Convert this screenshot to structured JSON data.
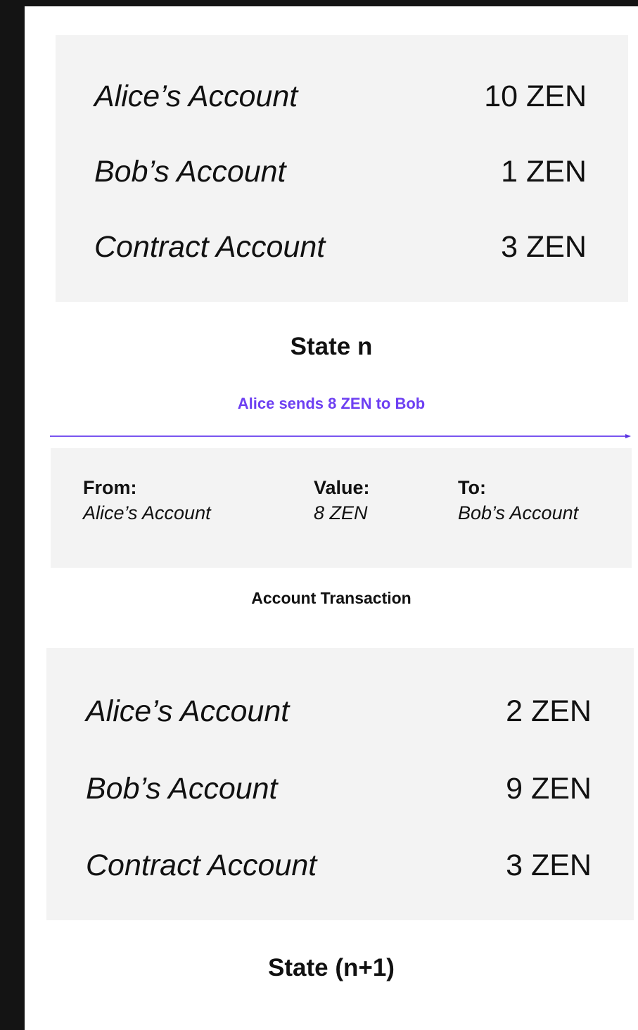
{
  "state_before": {
    "accounts": [
      {
        "name": "Alice’s Account",
        "value": "10 ZEN"
      },
      {
        "name": "Bob’s Account",
        "value": "1 ZEN"
      },
      {
        "name": "Contract Account",
        "value": "3 ZEN"
      }
    ],
    "caption": "State n"
  },
  "action": {
    "label": "Alice sends 8 ZEN to Bob",
    "color": "#6d3ff2"
  },
  "transaction": {
    "from_label": "From:",
    "from_value": "Alice’s Account",
    "value_label": "Value:",
    "value_value": "8 ZEN",
    "to_label": "To:",
    "to_value": "Bob’s Account",
    "caption": "Account Transaction"
  },
  "state_after": {
    "accounts": [
      {
        "name": "Alice’s Account",
        "value": "2 ZEN"
      },
      {
        "name": "Bob’s Account",
        "value": "9 ZEN"
      },
      {
        "name": "Contract Account",
        "value": "3 ZEN"
      }
    ],
    "caption": "State (n+1)"
  }
}
